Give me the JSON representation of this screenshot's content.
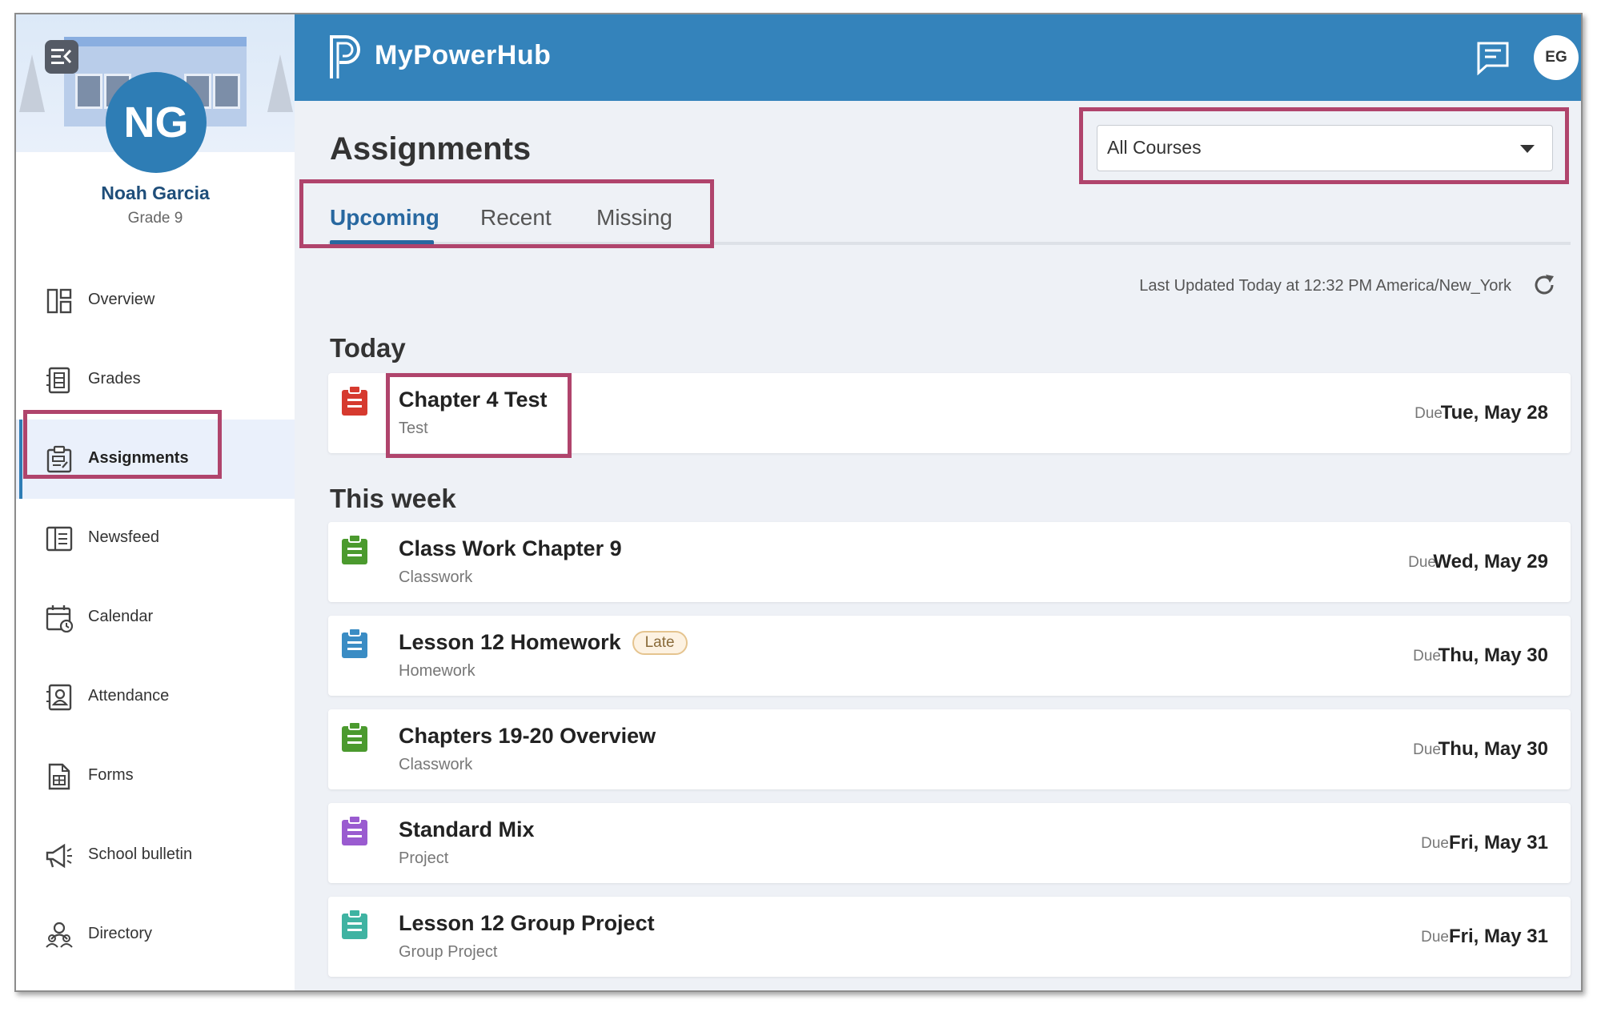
{
  "app": {
    "title": "MyPowerHub"
  },
  "user": {
    "initials": "EG"
  },
  "student": {
    "initials": "NG",
    "name": "Noah Garcia",
    "grade": "Grade 9"
  },
  "sidebar": {
    "items": [
      {
        "label": "Overview",
        "icon": "overview-icon"
      },
      {
        "label": "Grades",
        "icon": "grades-icon"
      },
      {
        "label": "Assignments",
        "icon": "assignments-icon",
        "active": true
      },
      {
        "label": "Newsfeed",
        "icon": "newsfeed-icon"
      },
      {
        "label": "Calendar",
        "icon": "calendar-icon"
      },
      {
        "label": "Attendance",
        "icon": "attendance-icon"
      },
      {
        "label": "Forms",
        "icon": "forms-icon"
      },
      {
        "label": "School bulletin",
        "icon": "megaphone-icon"
      },
      {
        "label": "Directory",
        "icon": "directory-icon"
      }
    ]
  },
  "main": {
    "title": "Assignments",
    "course_filter": {
      "selected": "All Courses"
    },
    "tabs": [
      {
        "label": "Upcoming",
        "active": true
      },
      {
        "label": "Recent"
      },
      {
        "label": "Missing"
      }
    ],
    "last_updated": "Last Updated Today at 12:32 PM America/New_York",
    "sections": [
      {
        "heading": "Today",
        "assignments": [
          {
            "title": "Chapter 4 Test",
            "type": "Test",
            "due_label": "Due",
            "due": "Tue, May 28",
            "color": "#d63a2f"
          }
        ]
      },
      {
        "heading": "This week",
        "assignments": [
          {
            "title": "Class Work Chapter 9",
            "type": "Classwork",
            "due_label": "Due",
            "due": "Wed, May 29",
            "color": "#4b9a2e"
          },
          {
            "title": "Lesson 12 Homework",
            "type": "Homework",
            "due_label": "Due",
            "due": "Thu, May 30",
            "color": "#3a8cc4",
            "badge": "Late"
          },
          {
            "title": "Chapters 19-20 Overview",
            "type": "Classwork",
            "due_label": "Due",
            "due": "Thu, May 30",
            "color": "#4b9a2e"
          },
          {
            "title": "Standard Mix",
            "type": "Project",
            "due_label": "Due",
            "due": "Fri, May 31",
            "color": "#9a5bd0"
          },
          {
            "title": "Lesson 12 Group Project",
            "type": "Group Project",
            "due_label": "Due",
            "due": "Fri, May 31",
            "color": "#3fb3a2"
          }
        ]
      }
    ]
  },
  "colors": {
    "header": "#3483bb",
    "accent": "#2868a0",
    "highlight": "#b0446c"
  }
}
